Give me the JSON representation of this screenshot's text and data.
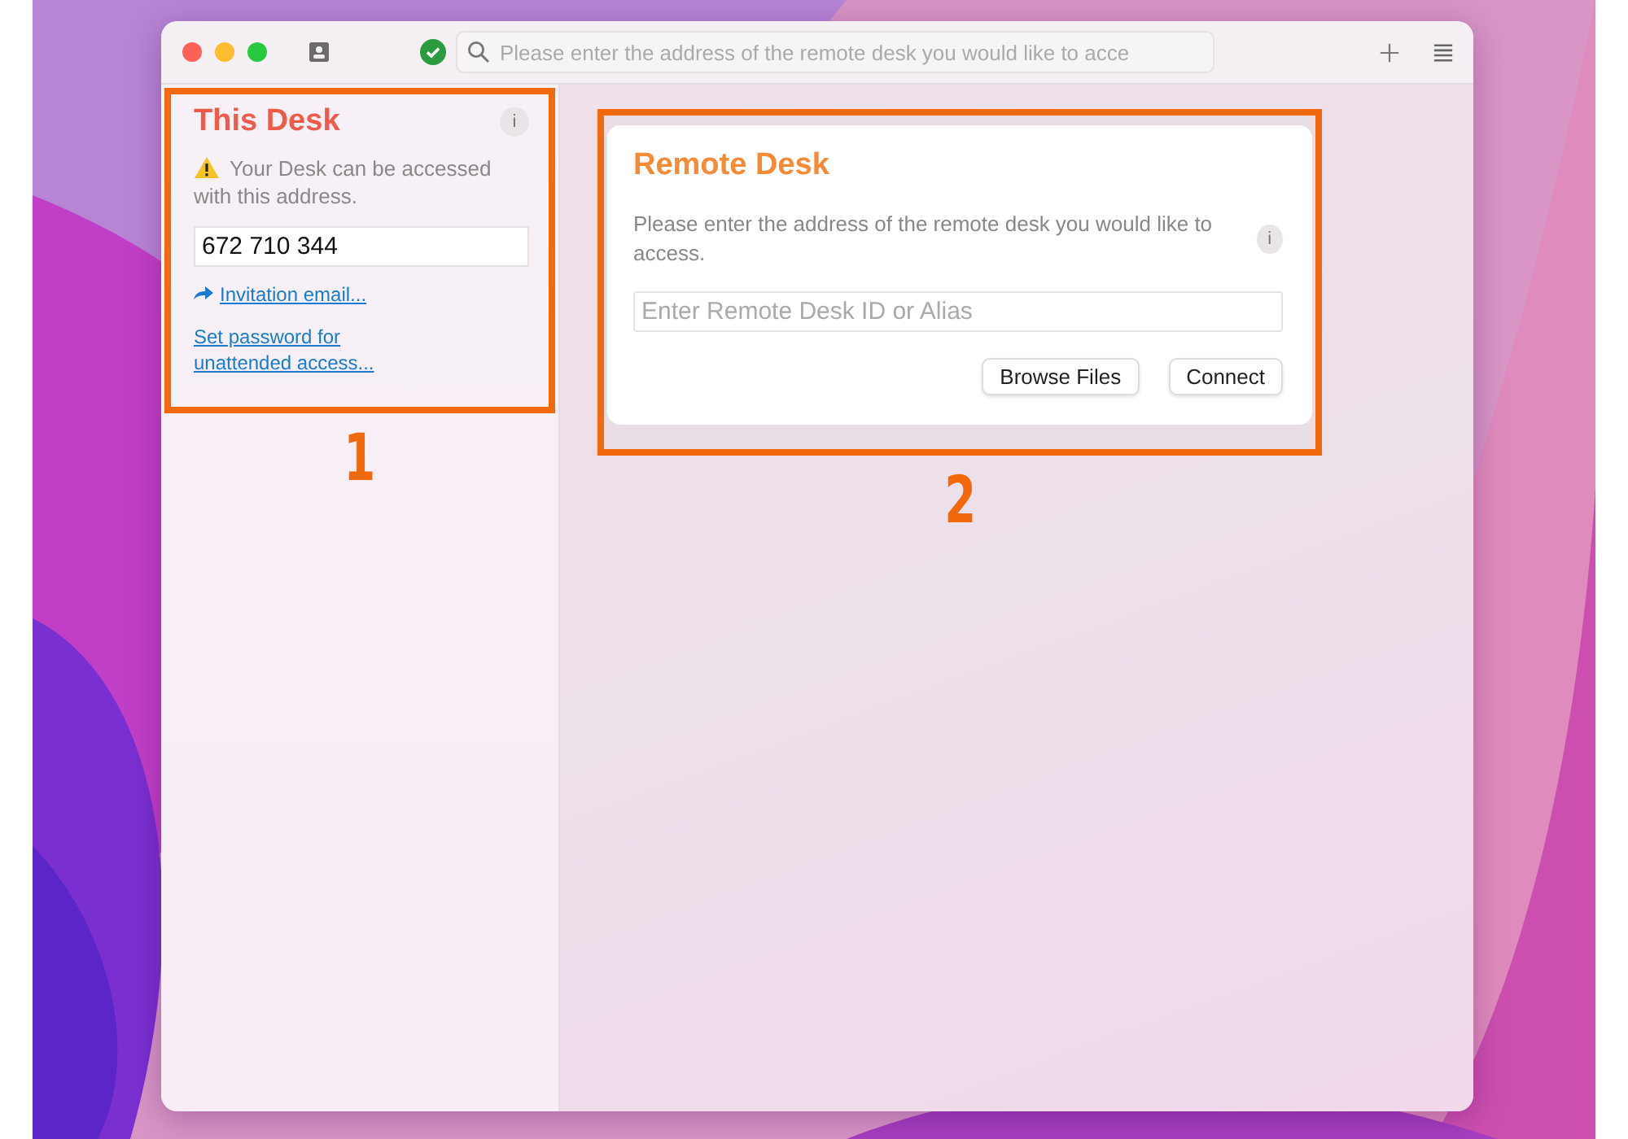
{
  "window": {
    "connected": true,
    "search": {
      "placeholder": "Please enter the address of the remote desk you would like to acce"
    }
  },
  "this_desk": {
    "title": "This Desk",
    "info": "i",
    "notice": "Your Desk can be accessed with this address.",
    "address": "672 710 344",
    "links": [
      {
        "kind": "share",
        "text": "Invitation email..."
      },
      {
        "kind": "plain",
        "text": "Set password for unattended access..."
      }
    ],
    "callout": "1"
  },
  "remote_desk": {
    "title": "Remote Desk",
    "description": "Please enter the address of the remote desk you would like to access.",
    "info": "i",
    "input": {
      "placeholder": "Enter Remote Desk ID or Alias"
    },
    "buttons": [
      "Browse Files",
      "Connect"
    ],
    "callout": "2"
  }
}
